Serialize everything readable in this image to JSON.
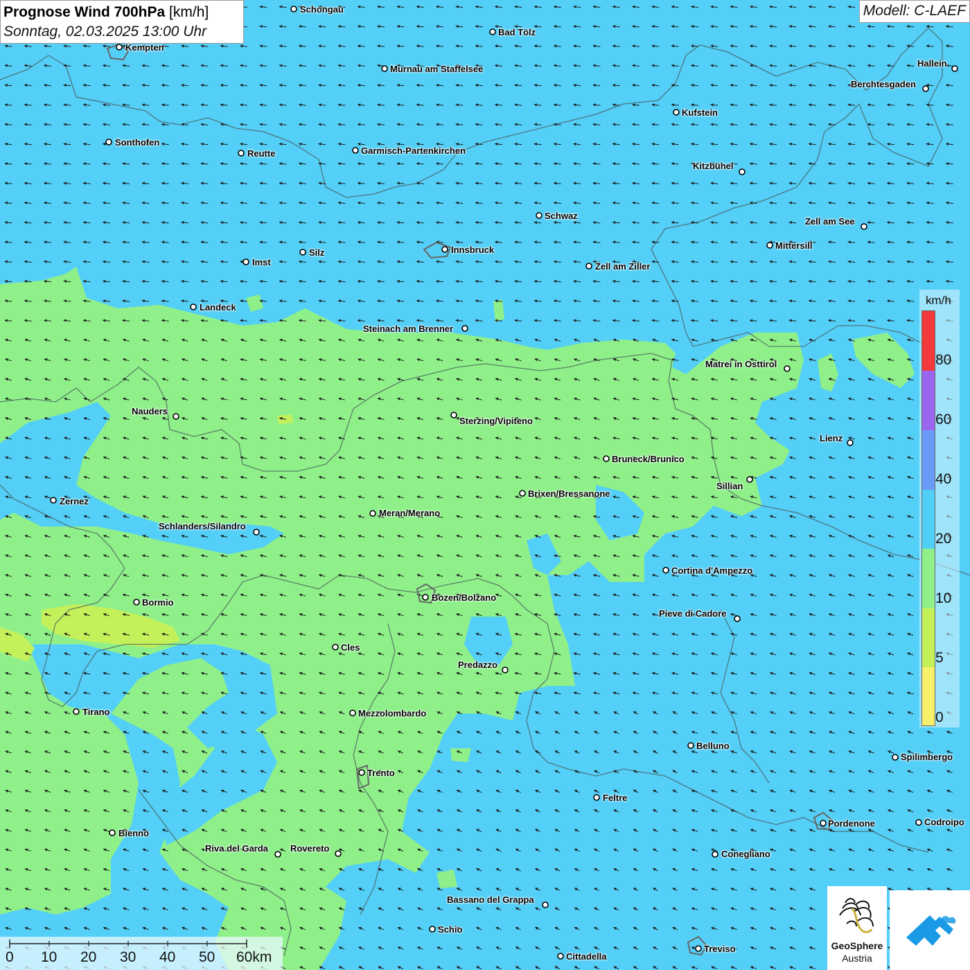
{
  "title": {
    "main_bold": "Prognose Wind 700hPa",
    "main_unit": "[km/h]",
    "date": "Sonntag, 02.03.2025 13:00 Uhr"
  },
  "model": "Modell: C-LAEF",
  "legend": {
    "unit": "km/h",
    "ticks": [
      "0",
      "5",
      "10",
      "20",
      "40",
      "60",
      "80"
    ],
    "colors": [
      "#f7f06a",
      "#c4f05a",
      "#8ff08a",
      "#4fcff5",
      "#6a9af7",
      "#9a66f0",
      "#f23a3a",
      "#c8e8f2"
    ]
  },
  "scale_bar": {
    "labels": [
      "0",
      "10",
      "20",
      "30",
      "40",
      "50",
      "60km"
    ]
  },
  "logos": {
    "geosphere_line1": "GeoSphere",
    "geosphere_line2": "Austria"
  },
  "cities": [
    {
      "name": "Schongau"
    },
    {
      "name": "Bad Tölz"
    },
    {
      "name": "Kempten"
    },
    {
      "name": "Murnau am Staffelsee"
    },
    {
      "name": "Hallein"
    },
    {
      "name": "Berchtesgaden"
    },
    {
      "name": "Kufstein"
    },
    {
      "name": "Sonthofen"
    },
    {
      "name": "Reutte"
    },
    {
      "name": "Garmisch-Partenkirchen"
    },
    {
      "name": "Kitzbühel"
    },
    {
      "name": "Schwaz"
    },
    {
      "name": "Zell am See"
    },
    {
      "name": "Mittersill"
    },
    {
      "name": "Innsbruck"
    },
    {
      "name": "Silz"
    },
    {
      "name": "Imst"
    },
    {
      "name": "Zell am Ziller"
    },
    {
      "name": "Landeck"
    },
    {
      "name": "Steinach am Brenner"
    },
    {
      "name": "Matrei in Osttirol"
    },
    {
      "name": "Nauders"
    },
    {
      "name": "Sterzing/Vipiteno"
    },
    {
      "name": "Lienz"
    },
    {
      "name": "Bruneck/Brunico"
    },
    {
      "name": "Sillian"
    },
    {
      "name": "Brixen/Bressanone"
    },
    {
      "name": "Zernez"
    },
    {
      "name": "Meran/Merano"
    },
    {
      "name": "Schlanders/Silandro"
    },
    {
      "name": "Cortina d'Ampezzo"
    },
    {
      "name": "Bozen/Bolzano"
    },
    {
      "name": "Bormio"
    },
    {
      "name": "Pieve di Cadore"
    },
    {
      "name": "Cles"
    },
    {
      "name": "Predazzo"
    },
    {
      "name": "Tirano"
    },
    {
      "name": "Mezzolombardo"
    },
    {
      "name": "Belluno"
    },
    {
      "name": "Spilimbergo"
    },
    {
      "name": "Trento"
    },
    {
      "name": "Feltre"
    },
    {
      "name": "Pordenone"
    },
    {
      "name": "Codroipo"
    },
    {
      "name": "Bienno"
    },
    {
      "name": "Riva del Garda"
    },
    {
      "name": "Rovereto"
    },
    {
      "name": "Conegliano"
    },
    {
      "name": "Bassano del Grappa"
    },
    {
      "name": "Schio"
    },
    {
      "name": "Treviso"
    },
    {
      "name": "Cittadella"
    }
  ]
}
